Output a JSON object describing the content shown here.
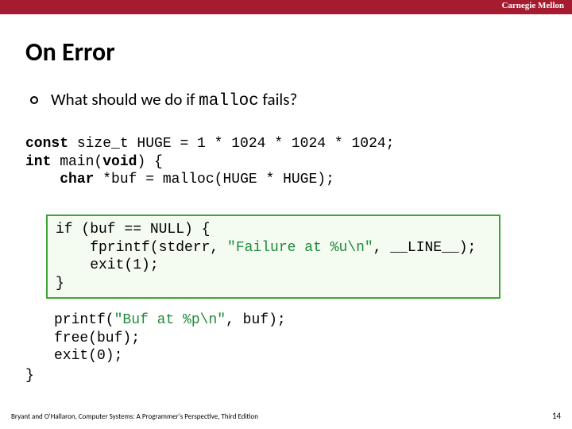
{
  "brand": "Carnegie Mellon",
  "title": "On Error",
  "bullet": {
    "prefix": "What should we do if ",
    "mono": "malloc",
    "suffix": " fails?"
  },
  "code_block1": {
    "l1a": "const",
    "l1b": " size_t HUGE = 1 * 1024 * 1024 * 1024;",
    "l2a": "int",
    "l2b": " main(",
    "l2c": "void",
    "l2d": ") {",
    "l3a": "    ",
    "l3b": "char",
    "l3c": " *buf = malloc(HUGE * HUGE);"
  },
  "code_highlight": {
    "l1": "if (buf == NULL) {",
    "l2a": "    fprintf(stderr, ",
    "l2b": "\"Failure at %u\\n\"",
    "l2c": ", __LINE__);",
    "l3": "    exit(1);",
    "l4": "}"
  },
  "code_block2": {
    "l1a": "printf(",
    "l1b": "\"Buf at %p\\n\"",
    "l1c": ", buf);",
    "l2": "free(buf);",
    "l3": "exit(0);"
  },
  "brace": "}",
  "footer": "Bryant and O'Hallaron, Computer Systems: A Programmer's Perspective, Third Edition",
  "page": "14"
}
